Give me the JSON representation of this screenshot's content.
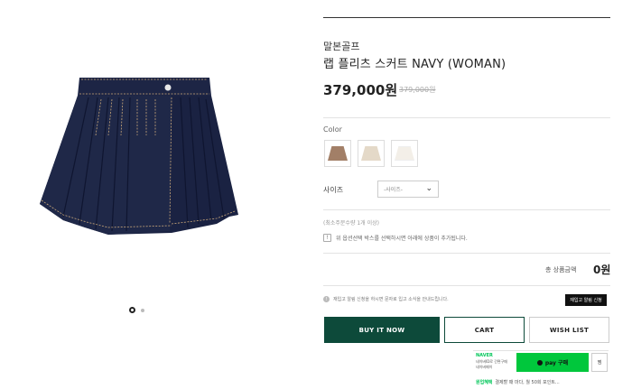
{
  "product": {
    "brand": "말본골프",
    "title": "랩 플리츠 스커트 NAVY (WOMAN)",
    "price": "379,000원",
    "original_price": "379,000원"
  },
  "carousel": {
    "total_slides": 2,
    "active_index": 0
  },
  "options": {
    "color_label": "Color",
    "swatches": [
      {
        "name": "brown",
        "color": "#a27f67"
      },
      {
        "name": "beige",
        "color": "#e4d9c8"
      },
      {
        "name": "white",
        "color": "#f3efe8"
      }
    ],
    "size_label": "사이즈",
    "size_placeholder": "-사이즈-"
  },
  "min_order_note": "(최소주문수량 1개 이상)",
  "info_note": "위 옵션선택 박스를 선택하시면 아래에 상품이 추가됩니다.",
  "total": {
    "label": "총 상품금액",
    "value": "0원"
  },
  "restock": {
    "notice": "재입고 알림 신청을 하시면 문자로 입고 소식을 안내드립니다.",
    "button": "재입고 알림 신청"
  },
  "actions": {
    "buy_now": "BUY IT NOW",
    "cart": "CART",
    "wishlist": "WISH LIST"
  },
  "naver": {
    "logo": "NAVER",
    "desc_line1": "네이버ID로 간편구매",
    "desc_line2": "네이버페이",
    "pay_button": "pay 구매",
    "jjim": "찜",
    "event_tag": "원업혜택",
    "event_text": "결제할 때 마다, 월 50회 포인트..."
  },
  "colors": {
    "brand_green": "#0d4a3a",
    "naver_green": "#00c73c",
    "skirt_navy": "#1d2545"
  }
}
